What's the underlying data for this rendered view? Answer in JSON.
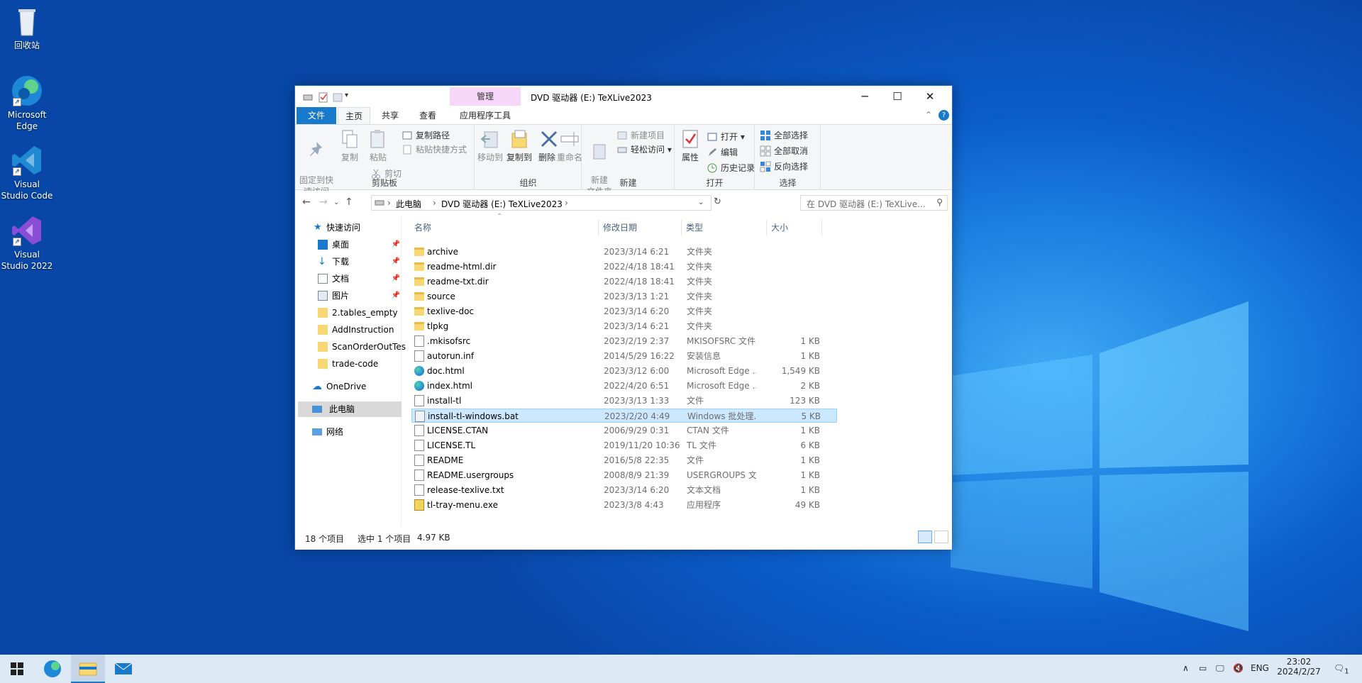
{
  "desktop": {
    "icons": [
      {
        "label": "回收站"
      },
      {
        "label": "Microsoft Edge"
      },
      {
        "label": "Visual Studio Code"
      },
      {
        "label": "Visual Studio 2022"
      }
    ]
  },
  "window": {
    "title": "DVD 驱动器 (E:) TeXLive2023",
    "manage_tab": "管理",
    "tabs": {
      "file": "文件",
      "home": "主页",
      "share": "共享",
      "view": "查看",
      "apptools": "应用程序工具"
    },
    "minimize": "─",
    "maximize": "☐",
    "close": "✕"
  },
  "ribbon": {
    "clipboard": {
      "label": "剪贴板",
      "pin": "固定到快\n速访问",
      "copy": "复制",
      "paste": "粘贴",
      "copy_path": "复制路径",
      "paste_shortcut": "粘贴快捷方式",
      "cut": "剪切"
    },
    "organize": {
      "label": "组织",
      "move_to": "移动到",
      "copy_to": "复制到",
      "delete": "删除",
      "rename": "重命名"
    },
    "new": {
      "label": "新建",
      "new_folder": "新建\n文件夹",
      "new_item": "新建项目",
      "easy_access": "轻松访问"
    },
    "open": {
      "label": "打开",
      "properties": "属性",
      "open": "打开",
      "edit": "编辑",
      "history": "历史记录"
    },
    "select": {
      "label": "选择",
      "select_all": "全部选择",
      "select_none": "全部取消",
      "invert": "反向选择"
    }
  },
  "address": {
    "crumbs": [
      "此电脑",
      "DVD 驱动器 (E:) TeXLive2023"
    ],
    "search_placeholder": "在 DVD 驱动器 (E:) TeXLive..."
  },
  "navpane": {
    "quick_access": "快速访问",
    "items": [
      "桌面",
      "下载",
      "文档",
      "图片",
      "2.tables_empty",
      "AddInstruction",
      "ScanOrderOutTes",
      "trade-code"
    ],
    "onedrive": "OneDrive",
    "thispc": "此电脑",
    "network": "网络"
  },
  "columns": {
    "name": "名称",
    "date": "修改日期",
    "type": "类型",
    "size": "大小"
  },
  "files": [
    {
      "name": "archive",
      "date": "2023/3/14 6:21",
      "type": "文件夹",
      "size": "",
      "icon": "folder"
    },
    {
      "name": "readme-html.dir",
      "date": "2022/4/18 18:41",
      "type": "文件夹",
      "size": "",
      "icon": "folder"
    },
    {
      "name": "readme-txt.dir",
      "date": "2022/4/18 18:41",
      "type": "文件夹",
      "size": "",
      "icon": "folder"
    },
    {
      "name": "source",
      "date": "2023/3/13 1:21",
      "type": "文件夹",
      "size": "",
      "icon": "folder"
    },
    {
      "name": "texlive-doc",
      "date": "2023/3/14 6:20",
      "type": "文件夹",
      "size": "",
      "icon": "folder"
    },
    {
      "name": "tlpkg",
      "date": "2023/3/14 6:21",
      "type": "文件夹",
      "size": "",
      "icon": "folder"
    },
    {
      "name": ".mkisofsrc",
      "date": "2023/2/19 2:37",
      "type": "MKISOFSRC 文件",
      "size": "1 KB",
      "icon": "doc"
    },
    {
      "name": "autorun.inf",
      "date": "2014/5/29 16:22",
      "type": "安装信息",
      "size": "1 KB",
      "icon": "doc"
    },
    {
      "name": "doc.html",
      "date": "2023/3/12 6:00",
      "type": "Microsoft Edge ...",
      "size": "1,549 KB",
      "icon": "edge"
    },
    {
      "name": "index.html",
      "date": "2022/4/20 6:51",
      "type": "Microsoft Edge ...",
      "size": "2 KB",
      "icon": "edge"
    },
    {
      "name": "install-tl",
      "date": "2023/3/13 1:33",
      "type": "文件",
      "size": "123 KB",
      "icon": "doc"
    },
    {
      "name": "install-tl-windows.bat",
      "date": "2023/2/20 4:49",
      "type": "Windows 批处理...",
      "size": "5 KB",
      "icon": "bat",
      "selected": true
    },
    {
      "name": "LICENSE.CTAN",
      "date": "2006/9/29 0:31",
      "type": "CTAN 文件",
      "size": "1 KB",
      "icon": "doc"
    },
    {
      "name": "LICENSE.TL",
      "date": "2019/11/20 10:36",
      "type": "TL 文件",
      "size": "6 KB",
      "icon": "doc"
    },
    {
      "name": "README",
      "date": "2016/5/8 22:35",
      "type": "文件",
      "size": "1 KB",
      "icon": "doc"
    },
    {
      "name": "README.usergroups",
      "date": "2008/8/9 21:39",
      "type": "USERGROUPS 文...",
      "size": "1 KB",
      "icon": "doc"
    },
    {
      "name": "release-texlive.txt",
      "date": "2023/3/14 6:20",
      "type": "文本文档",
      "size": "1 KB",
      "icon": "doc"
    },
    {
      "name": "tl-tray-menu.exe",
      "date": "2023/3/8 4:43",
      "type": "应用程序",
      "size": "49 KB",
      "icon": "exe"
    }
  ],
  "status": {
    "count": "18 个项目",
    "selected": "选中 1 个项目",
    "size": "4.97 KB"
  },
  "taskbar": {
    "lang": "ENG",
    "time": "23:02",
    "date": "2024/2/27",
    "notif_count": "1"
  },
  "colors": {
    "accent": "#1979ca",
    "selection": "#cce8ff",
    "manage_tab": "#f6d7fa"
  }
}
